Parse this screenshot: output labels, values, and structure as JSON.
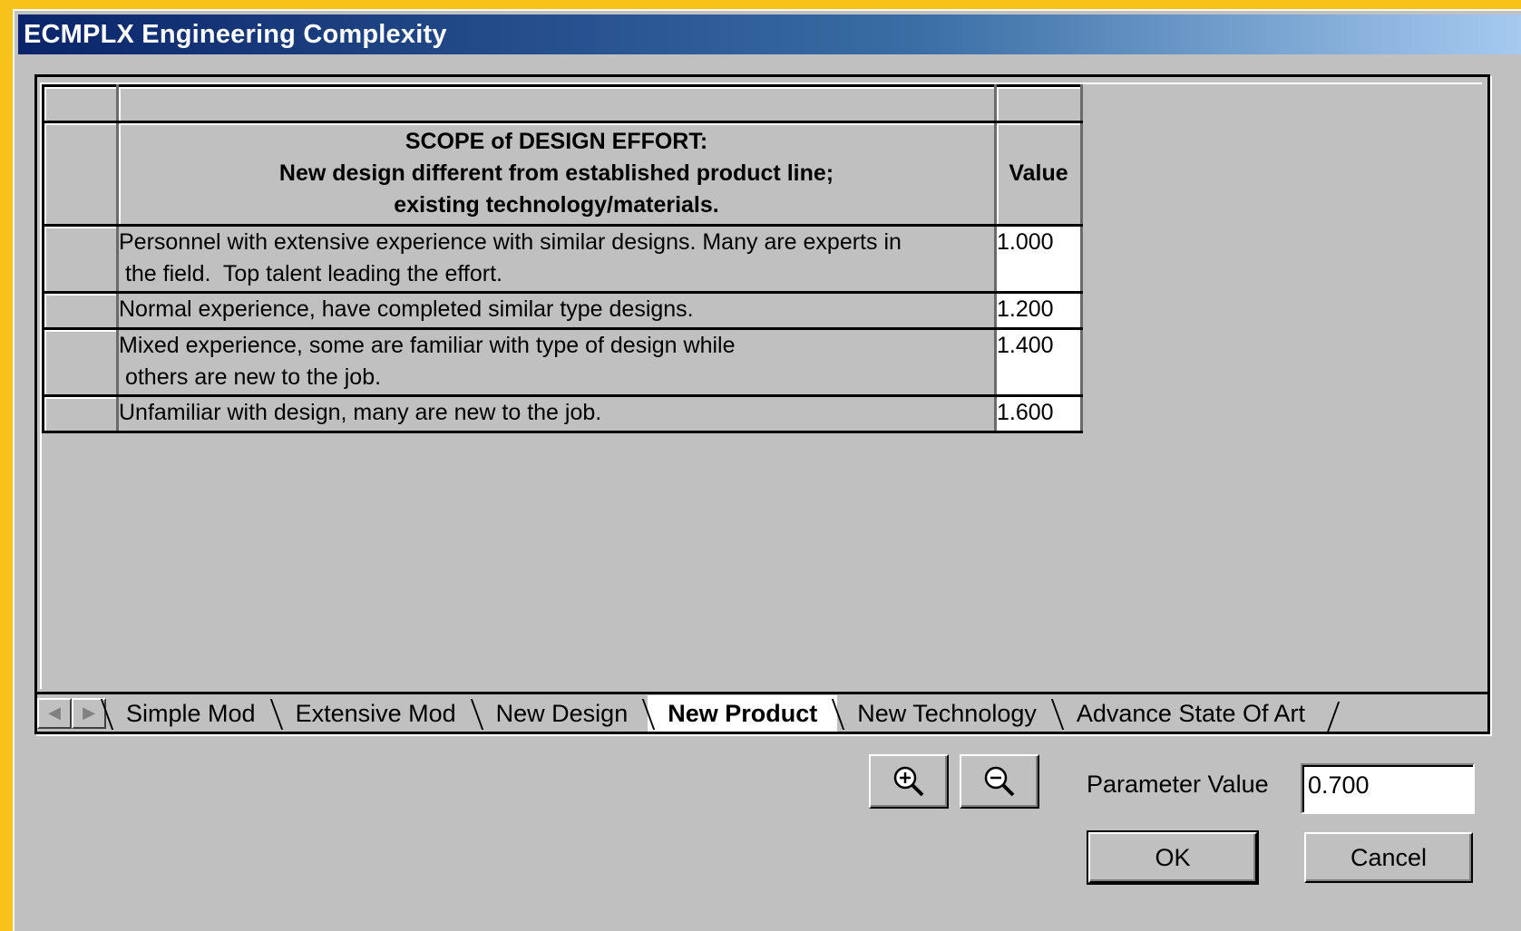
{
  "window": {
    "title": "ECMPLX  Engineering Complexity"
  },
  "table": {
    "header_lines": [
      "SCOPE of DESIGN EFFORT:",
      "New design different from established product line;",
      "existing technology/materials."
    ],
    "value_header": "Value",
    "rows": [
      {
        "desc_lines": [
          "Personnel with extensive experience with similar designs.  Many are experts in",
          " the field.  Top talent leading the effort."
        ],
        "value": "1.000"
      },
      {
        "desc_lines": [
          "Normal experience, have completed similar type designs."
        ],
        "value": "1.200"
      },
      {
        "desc_lines": [
          "Mixed experience, some are familiar with type of design while",
          " others are new to the job."
        ],
        "value": "1.400"
      },
      {
        "desc_lines": [
          "Unfamiliar with design, many are new to the job."
        ],
        "value": "1.600"
      }
    ]
  },
  "tabs": [
    {
      "label": "Simple Mod",
      "active": false
    },
    {
      "label": "Extensive Mod",
      "active": false
    },
    {
      "label": "New Design",
      "active": false
    },
    {
      "label": "New Product",
      "active": true
    },
    {
      "label": "New Technology",
      "active": false
    },
    {
      "label": "Advance State Of Art",
      "active": false
    }
  ],
  "controls": {
    "zoom_in_icon": "magnifier-plus-icon",
    "zoom_out_icon": "magnifier-minus-icon",
    "parameter_label": "Parameter Value",
    "parameter_value": "0.700",
    "ok_label": "OK",
    "cancel_label": "Cancel"
  }
}
